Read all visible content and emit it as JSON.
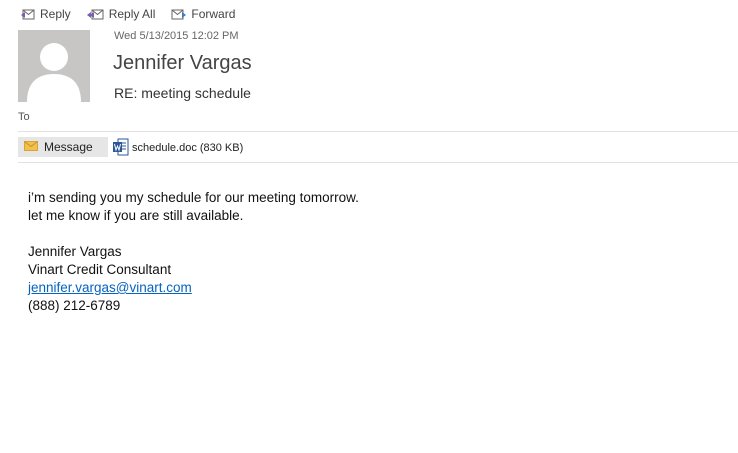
{
  "toolbar": {
    "reply_label": "Reply",
    "reply_all_label": "Reply All",
    "forward_label": "Forward"
  },
  "header": {
    "date": "Wed 5/13/2015 12:02 PM",
    "sender": "Jennifer Vargas",
    "subject": "RE: meeting schedule",
    "to_label": "To"
  },
  "tabs": {
    "message_label": "Message"
  },
  "attachment": {
    "filename": "schedule.doc",
    "size": "(830 KB)"
  },
  "body": {
    "line1": "i’m sending you my schedule for our meeting tomorrow.",
    "line2": "let me know if you are still available.",
    "sig_name": "Jennifer Vargas",
    "sig_title": "Vinart Credit Consultant",
    "sig_email": "jennifer.vargas@vinart.com",
    "sig_phone": "(888) 212-6789"
  },
  "colors": {
    "link": "#0563c1",
    "toolbar_icon": "#7a5ab3",
    "forward_icon": "#3b7bbf",
    "word_icon": "#2b5797"
  }
}
